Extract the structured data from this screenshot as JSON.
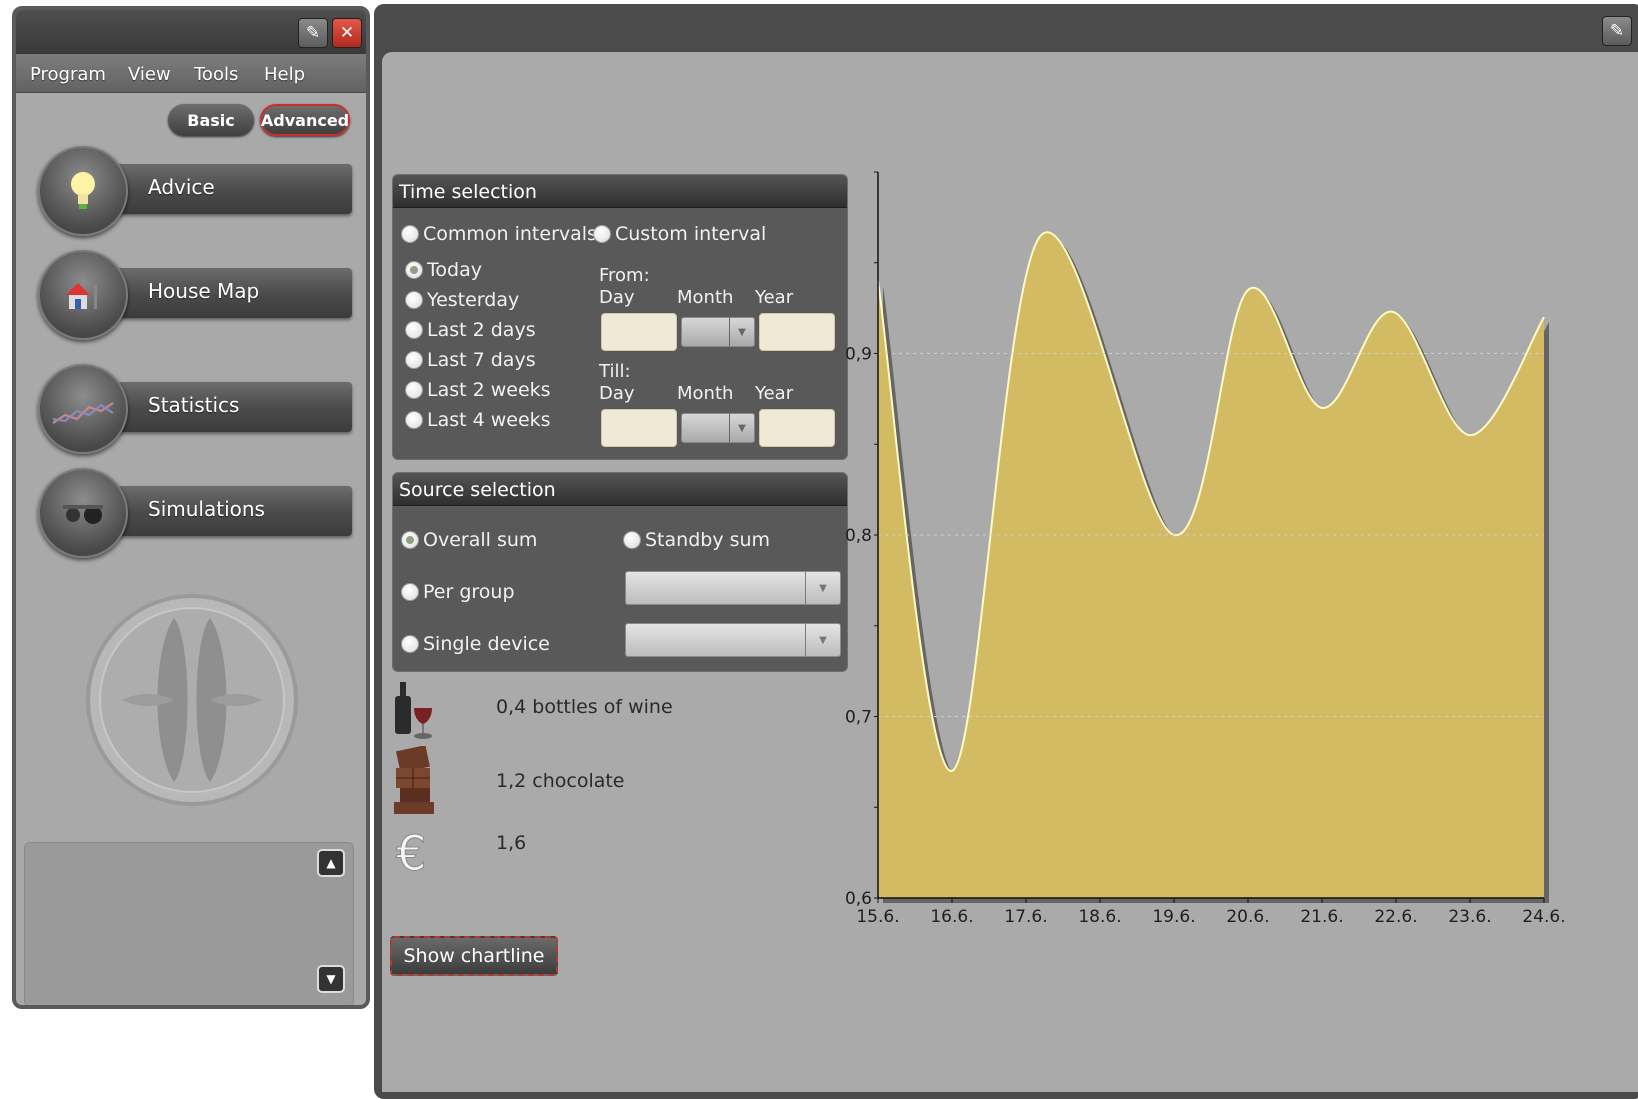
{
  "left_panel": {
    "menu": [
      "Program",
      "View",
      "Tools",
      "Help"
    ],
    "mode": {
      "basic": "Basic",
      "advanced": "Advanced",
      "selected": "Advanced"
    },
    "nav": [
      {
        "label": "Advice",
        "icon": "lightbulb-icon"
      },
      {
        "label": "House Map",
        "icon": "house-icon"
      },
      {
        "label": "Statistics",
        "icon": "chart-icon"
      },
      {
        "label": "Simulations",
        "icon": "simulation-icon"
      }
    ]
  },
  "time_selection": {
    "title": "Time selection",
    "mode_options": [
      "Common intervals",
      "Custom interval"
    ],
    "intervals": [
      "Today",
      "Yesterday",
      "Last 2 days",
      "Last 7 days",
      "Last 2 weeks",
      "Last 4 weeks"
    ],
    "selected_interval": "Today",
    "from_label": "From:",
    "till_label": "Till:",
    "day_label": "Day",
    "month_label": "Month",
    "year_label": "Year"
  },
  "source_selection": {
    "title": "Source selection",
    "overall_sum": "Overall sum",
    "standby_sum": "Standby sum",
    "per_group": "Per group",
    "single_device": "Single device",
    "selected": "Overall sum"
  },
  "equivalents": [
    {
      "icon": "wine-bottle-icon",
      "text": "0,4 bottles of wine"
    },
    {
      "icon": "chocolate-icon",
      "text": "1,2 chocolate"
    },
    {
      "icon": "euro-icon",
      "text": "1,6"
    }
  ],
  "buttons": {
    "show_chartline": "Show chartline"
  },
  "chart_data": {
    "type": "area",
    "x": [
      "15.6.",
      "16.6.",
      "17.6.",
      "18.6.",
      "19.6.",
      "20.6.",
      "21.6.",
      "22.6.",
      "23.6.",
      "24.6."
    ],
    "values": [
      0.94,
      0.67,
      0.965,
      0.8,
      0.935,
      0.87,
      0.923,
      0.855,
      0.92
    ],
    "value_positions": [
      0,
      1,
      2.2,
      4,
      5.0,
      6.0,
      6.95,
      8.0,
      9.0
    ],
    "y_ticks": [
      "0,6",
      "0,7",
      "0,8",
      "0,9"
    ],
    "ylim": [
      0.6,
      1.0
    ],
    "fill_color": "#d2bb62",
    "line_color": "#fff9c4",
    "grid": true,
    "title": "",
    "xlabel": "",
    "ylabel": ""
  }
}
